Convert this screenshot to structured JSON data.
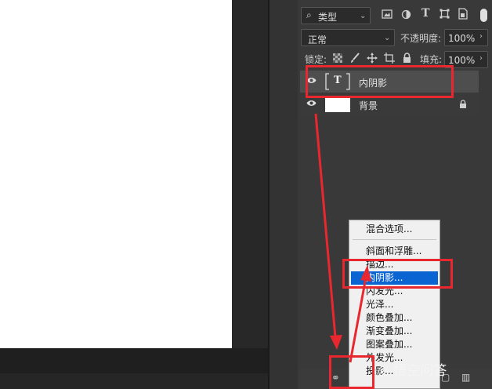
{
  "layers_panel": {
    "filter": {
      "kind_label": "类型"
    },
    "blend": {
      "mode": "正常",
      "opacity_label": "不透明度:",
      "opacity_value": "100%"
    },
    "lock": {
      "label": "锁定:",
      "fill_label": "填充:",
      "fill_value": "100%"
    },
    "layers": [
      {
        "name": "内阴影",
        "thumb_glyph": "T"
      },
      {
        "name": "背景"
      }
    ]
  },
  "context_menu": {
    "items": [
      {
        "label": "混合选项..."
      },
      {
        "label": "斜面和浮雕..."
      },
      {
        "label": "描边..."
      },
      {
        "label": "内阴影..."
      },
      {
        "label": "内发光..."
      },
      {
        "label": "光泽..."
      },
      {
        "label": "颜色叠加..."
      },
      {
        "label": "渐变叠加..."
      },
      {
        "label": "图案叠加..."
      },
      {
        "label": "外发光..."
      },
      {
        "label": "投影..."
      }
    ],
    "selected_label": "内阴影..."
  },
  "watermark": {
    "text": "悟空问答"
  },
  "colors": {
    "highlight": "#0a64d2",
    "annotation_red": "#e8282e",
    "panel_bg": "#393939"
  }
}
